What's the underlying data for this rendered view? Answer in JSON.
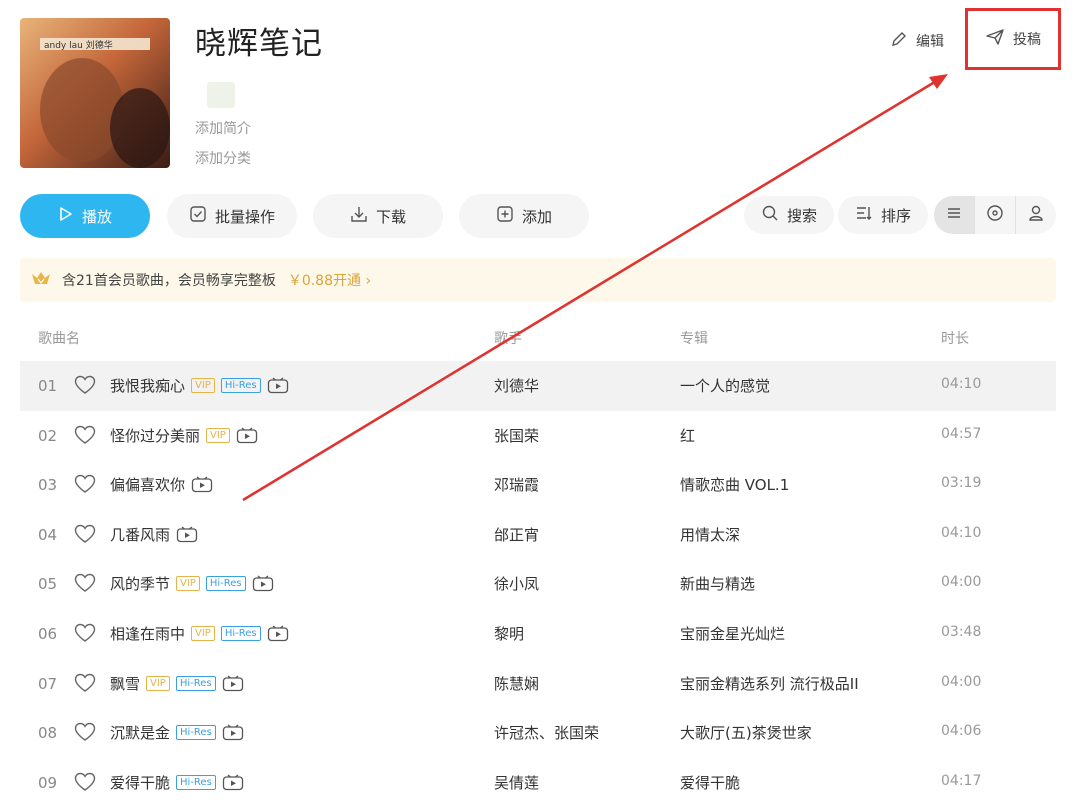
{
  "header": {
    "cover_text_line1": "andy lau 刘德华",
    "title": "晓辉笔记",
    "intro_placeholder": "添加简介",
    "category_placeholder": "添加分类",
    "edit_label": "编辑",
    "submit_label": "投稿"
  },
  "toolbar": {
    "play_label": "播放",
    "batch_label": "批量操作",
    "download_label": "下载",
    "add_label": "添加",
    "search_label": "搜索",
    "sort_label": "排序"
  },
  "vip_banner": {
    "text": "含21首会员歌曲，会员畅享完整板",
    "cta": "￥0.88开通 ›"
  },
  "table": {
    "headers": {
      "name": "歌曲名",
      "artist": "歌手",
      "album": "专辑",
      "duration": "时长"
    },
    "rows": [
      {
        "num": "01",
        "name": "我恨我痴心",
        "vip": true,
        "hires": true,
        "artist": "刘德华",
        "album": "一个人的感觉",
        "duration": "04:10"
      },
      {
        "num": "02",
        "name": "怪你过分美丽",
        "vip": true,
        "hires": false,
        "artist": "张国荣",
        "album": "红",
        "duration": "04:57"
      },
      {
        "num": "03",
        "name": "偏偏喜欢你",
        "vip": false,
        "hires": false,
        "artist": "邓瑞霞",
        "album": "情歌恋曲 VOL.1",
        "duration": "03:19"
      },
      {
        "num": "04",
        "name": "几番风雨",
        "vip": false,
        "hires": false,
        "artist": "邰正宵",
        "album": "用情太深",
        "duration": "04:10"
      },
      {
        "num": "05",
        "name": "风的季节",
        "vip": true,
        "hires": true,
        "artist": "徐小凤",
        "album": "新曲与精选",
        "duration": "04:00"
      },
      {
        "num": "06",
        "name": "相逢在雨中",
        "vip": true,
        "hires": true,
        "artist": "黎明",
        "album": "宝丽金星光灿烂",
        "duration": "03:48"
      },
      {
        "num": "07",
        "name": "飘雪",
        "vip": true,
        "hires": true,
        "artist": "陈慧娴",
        "album": "宝丽金精选系列 流行极品II",
        "duration": "04:00"
      },
      {
        "num": "08",
        "name": "沉默是金",
        "vip": false,
        "hires": true,
        "artist": "许冠杰、张国荣",
        "album": "大歌厅(五)茶煲世家",
        "duration": "04:06"
      },
      {
        "num": "09",
        "name": "爱得干脆",
        "vip": false,
        "hires": true,
        "artist": "吴倩莲",
        "album": "爱得干脆",
        "duration": "04:17"
      }
    ],
    "badge_vip": "VIP",
    "badge_hires": "Hi-Res"
  },
  "colors": {
    "accent": "#2db6f0",
    "annotation_red": "#e0322f",
    "vip_gold": "#d9a53a"
  }
}
